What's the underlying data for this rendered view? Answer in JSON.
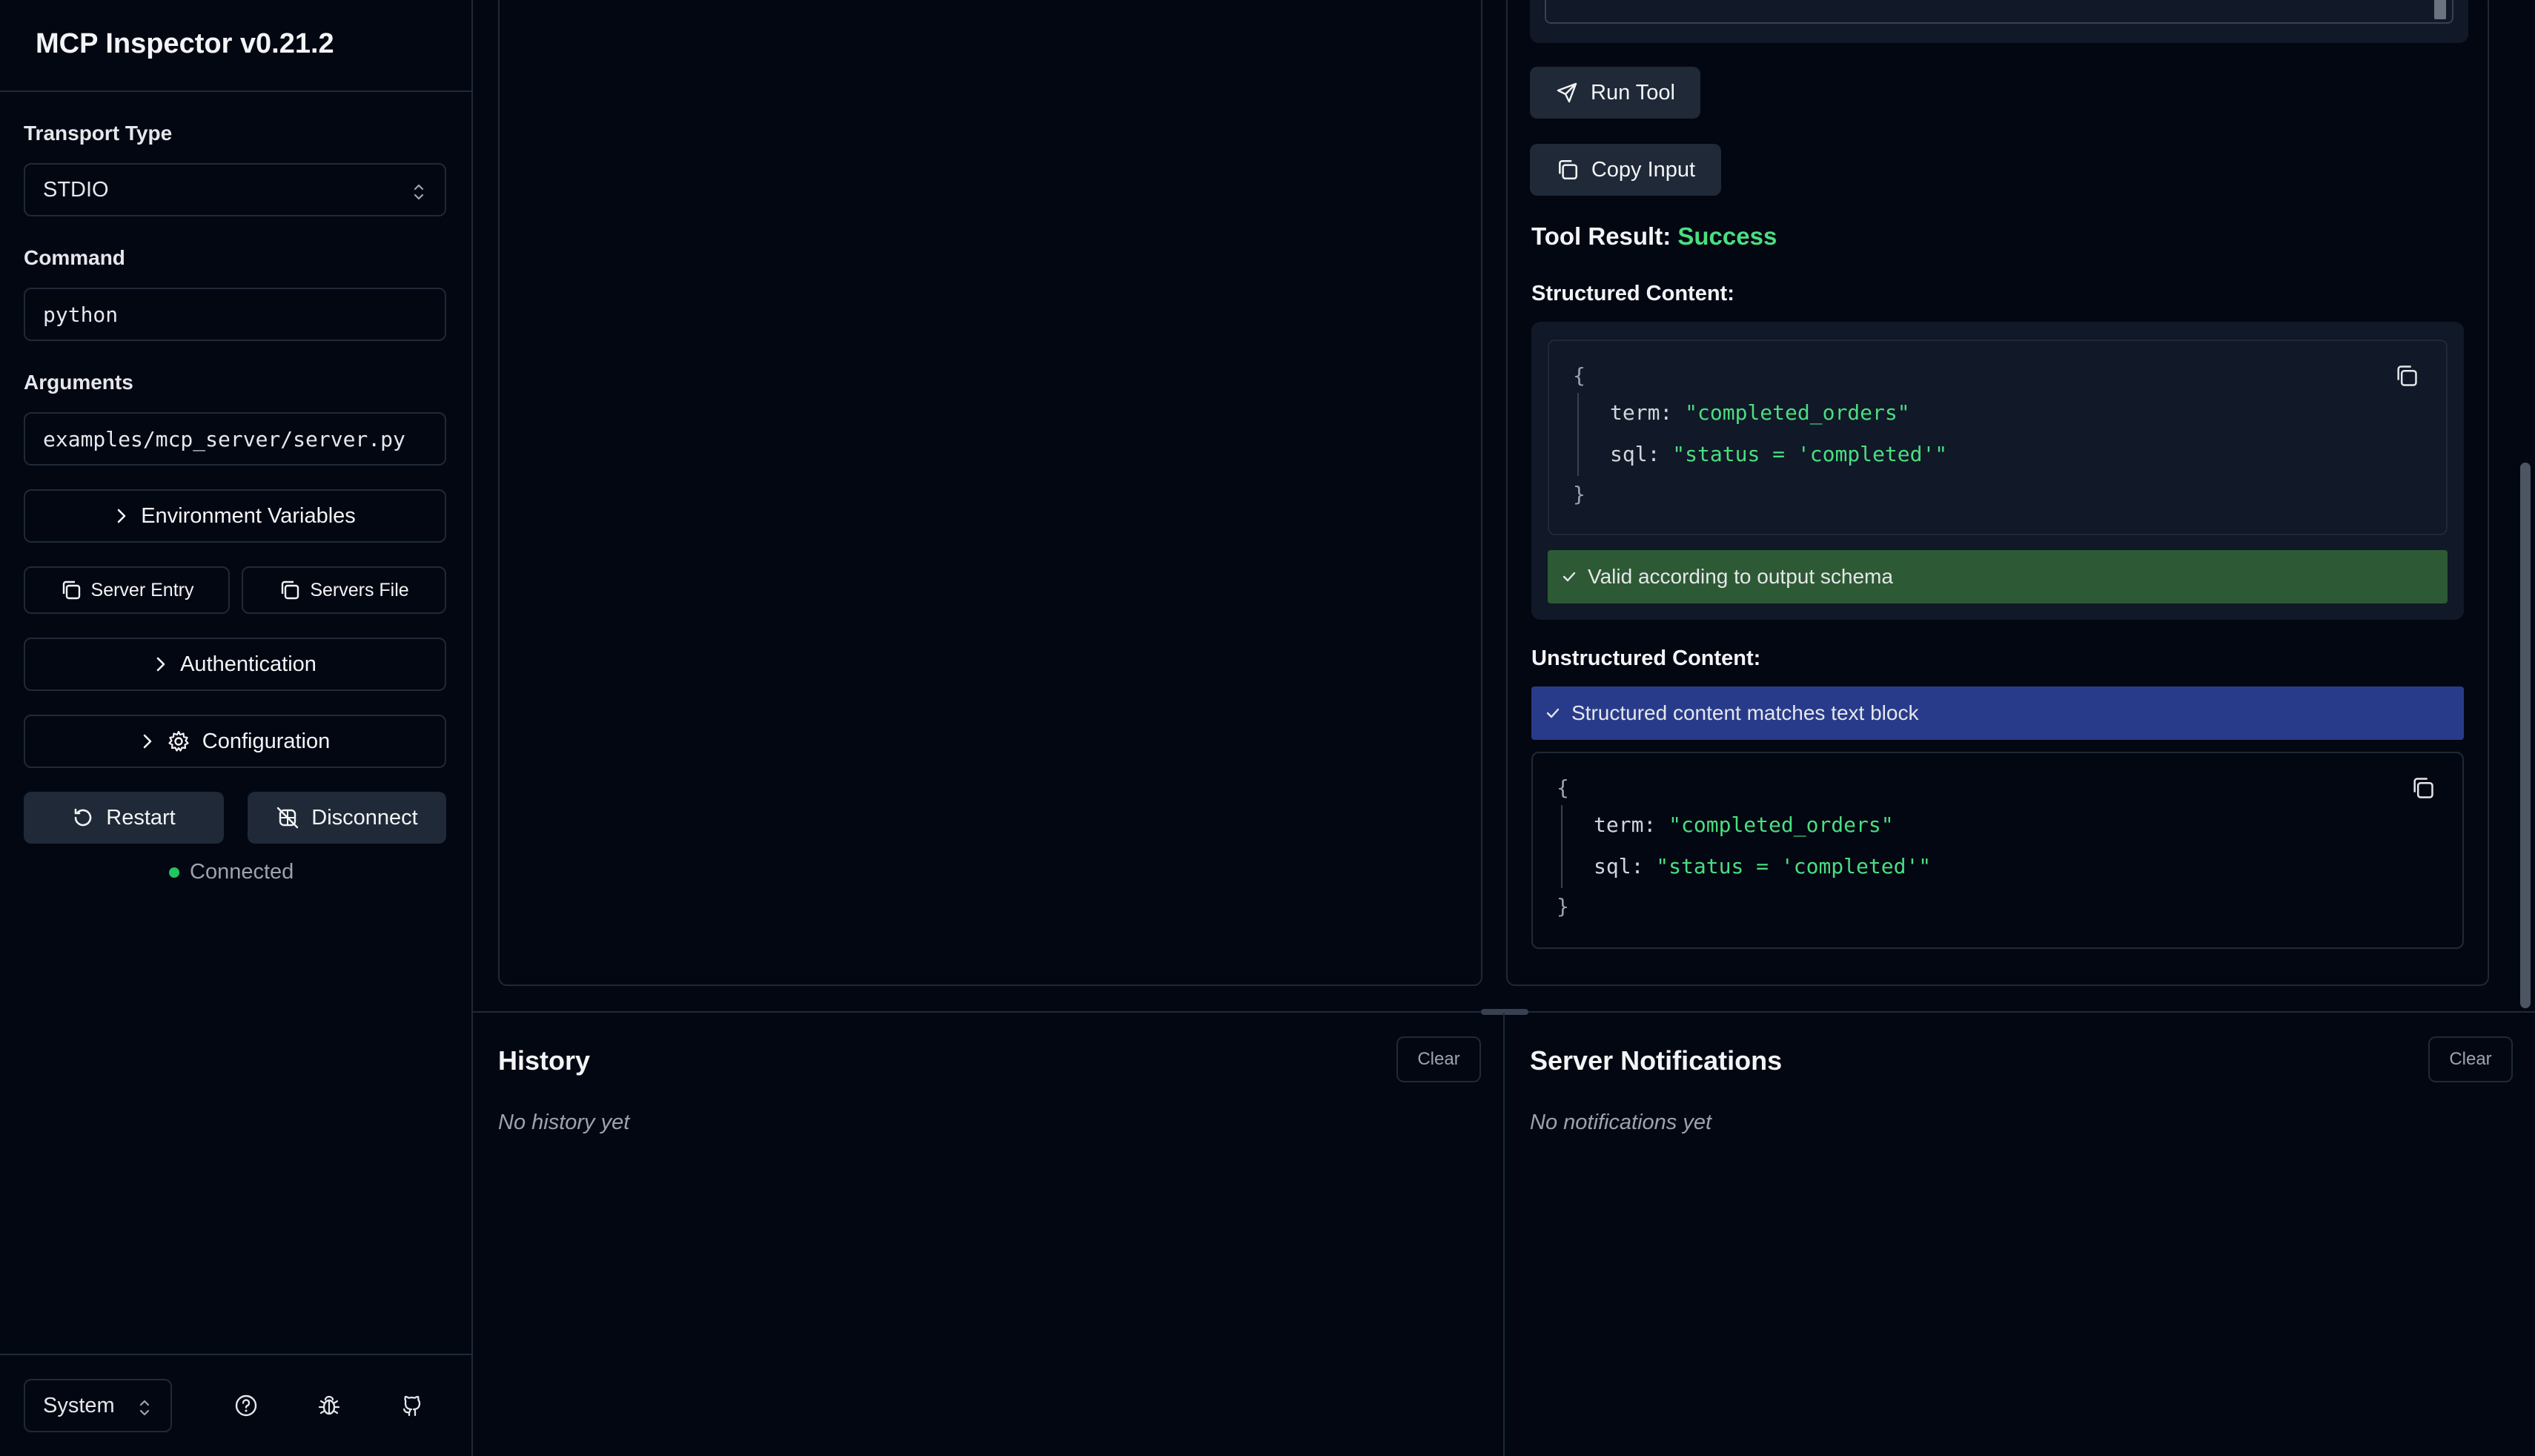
{
  "app": {
    "title": "MCP Inspector v0.21.2"
  },
  "sidebar": {
    "transport_label": "Transport Type",
    "transport_value": "STDIO",
    "command_label": "Command",
    "command_value": "python",
    "arguments_label": "Arguments",
    "arguments_value": "examples/mcp_server/server.py",
    "env_vars_label": "Environment Variables",
    "server_entry_label": "Server Entry",
    "servers_file_label": "Servers File",
    "authentication_label": "Authentication",
    "configuration_label": "Configuration",
    "restart_label": "Restart",
    "disconnect_label": "Disconnect",
    "status_text": "Connected",
    "status_color": "#22c55e",
    "theme_value": "System"
  },
  "tool": {
    "run_label": "Run Tool",
    "copy_input_label": "Copy Input",
    "result_label": "Tool Result:",
    "result_status": "Success",
    "structured_label": "Structured Content:",
    "unstructured_label": "Unstructured Content:",
    "valid_schema_text": "Valid according to output schema",
    "matches_text": "Structured content matches text block",
    "success_color": "#4ade80",
    "valid_bg": "#2d5a34",
    "match_bg": "#283b8a"
  },
  "structured_json": {
    "open": "{",
    "close": "}",
    "term_key": "term:",
    "term_value": "\"completed_orders\"",
    "sql_key": "sql:",
    "sql_value": "\"status = 'completed'\""
  },
  "unstructured_json": {
    "open": "{",
    "close": "}",
    "term_key": "term:",
    "term_value": "\"completed_orders\"",
    "sql_key": "sql:",
    "sql_value": "\"status = 'completed'\""
  },
  "history": {
    "title": "History",
    "clear_label": "Clear",
    "empty_text": "No history yet"
  },
  "notifications": {
    "title": "Server Notifications",
    "clear_label": "Clear",
    "empty_text": "No notifications yet"
  },
  "icons": [
    "chevron-updown-icon",
    "chevron-right-icon",
    "copy-icon",
    "gear-icon",
    "restart-icon",
    "disconnect-icon",
    "send-icon",
    "check-icon",
    "help-icon",
    "bug-icon",
    "github-icon"
  ]
}
